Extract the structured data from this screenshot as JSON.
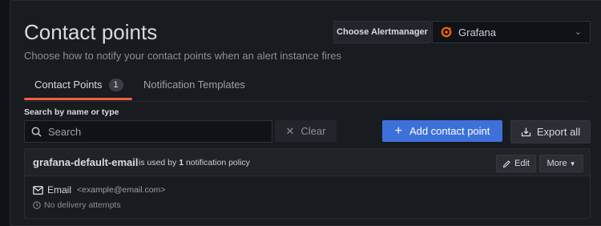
{
  "header": {
    "title": "Contact points",
    "subtitle": "Choose how to notify your contact points when an alert instance fires"
  },
  "alertmanager": {
    "label": "Choose Alertmanager",
    "selected": "Grafana",
    "logo_color": "#f46800"
  },
  "tabs": [
    {
      "label": "Contact Points",
      "count": "1",
      "active": true
    },
    {
      "label": "Notification Templates",
      "active": false
    }
  ],
  "search": {
    "label": "Search by name or type",
    "placeholder": "Search",
    "clear_label": "Clear"
  },
  "actions": {
    "add_label": "Add contact point",
    "export_label": "Export all"
  },
  "contact_point": {
    "name": "grafana-default-email",
    "usage_prefix": "is used by",
    "usage_count": "1",
    "usage_suffix": "notification policy",
    "edit_label": "Edit",
    "more_label": "More",
    "integration": {
      "type": "Email",
      "address": "<example@email.com>"
    },
    "delivery_status": "No delivery attempts"
  },
  "colors": {
    "accent_tab": "#f55f3e",
    "primary_button": "#3d71d9",
    "background": "#181b1f"
  }
}
